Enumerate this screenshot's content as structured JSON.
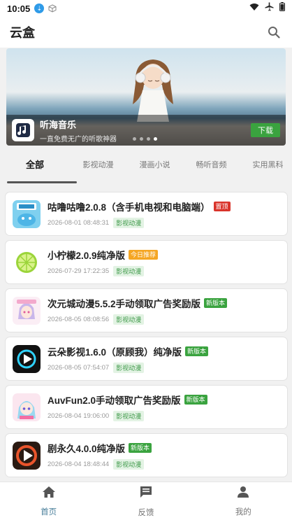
{
  "status": {
    "time": "10:05"
  },
  "app": {
    "title": "云盒"
  },
  "banner": {
    "title": "听海音乐",
    "subtitle": "一直免费无广的听歌神器",
    "download_label": "下载"
  },
  "tabs": [
    "全部",
    "影视动漫",
    "漫画小说",
    "畅听音频",
    "实用黑科"
  ],
  "items": [
    {
      "title": "咕噜咕噜2.0.8（含手机电视和电脑端）",
      "badge": "置顶",
      "badge_color": "#d9342b",
      "date": "2026-08-01 08:48:31",
      "category": "影视动漫",
      "icon": "gugu-app-icon"
    },
    {
      "title": "小柠檬2.0.9纯净版",
      "badge": "今日推荐",
      "badge_color": "#f5a623",
      "date": "2026-07-29 17:22:35",
      "category": "影视动漫",
      "icon": "lemon-app-icon"
    },
    {
      "title": "次元城动漫5.5.2手动领取广告奖励版",
      "badge": "新版本",
      "badge_color": "#3aa33f",
      "date": "2026-08-05 08:08:56",
      "category": "影视动漫",
      "icon": "ciyuancheng-app-icon"
    },
    {
      "title": "云朵影视1.6.0（原顾我）纯净版",
      "badge": "新版本",
      "badge_color": "#3aa33f",
      "date": "2026-08-05 07:54:07",
      "category": "影视动漫",
      "icon": "yunduo-app-icon"
    },
    {
      "title": "AuvFun2.0手动领取广告奖励版",
      "badge": "新版本",
      "badge_color": "#3aa33f",
      "date": "2026-08-04 19:06:00",
      "category": "影视动漫",
      "icon": "auvfun-app-icon"
    },
    {
      "title": "剧永久4.0.0纯净版",
      "badge": "新版本",
      "badge_color": "#3aa33f",
      "date": "2026-08-04 18:48:44",
      "category": "影视动漫",
      "icon": "juyongjiu-app-icon"
    }
  ],
  "bottom_nav": [
    {
      "label": "首页",
      "icon": "home-icon",
      "active": true
    },
    {
      "label": "反馈",
      "icon": "feedback-icon",
      "active": false
    },
    {
      "label": "我的",
      "icon": "profile-icon",
      "active": false
    }
  ],
  "colors": {
    "accent": "#4a7f9b",
    "top_badge": "#d9342b",
    "recommend_badge": "#f5a623",
    "new_badge": "#3aa33f"
  }
}
